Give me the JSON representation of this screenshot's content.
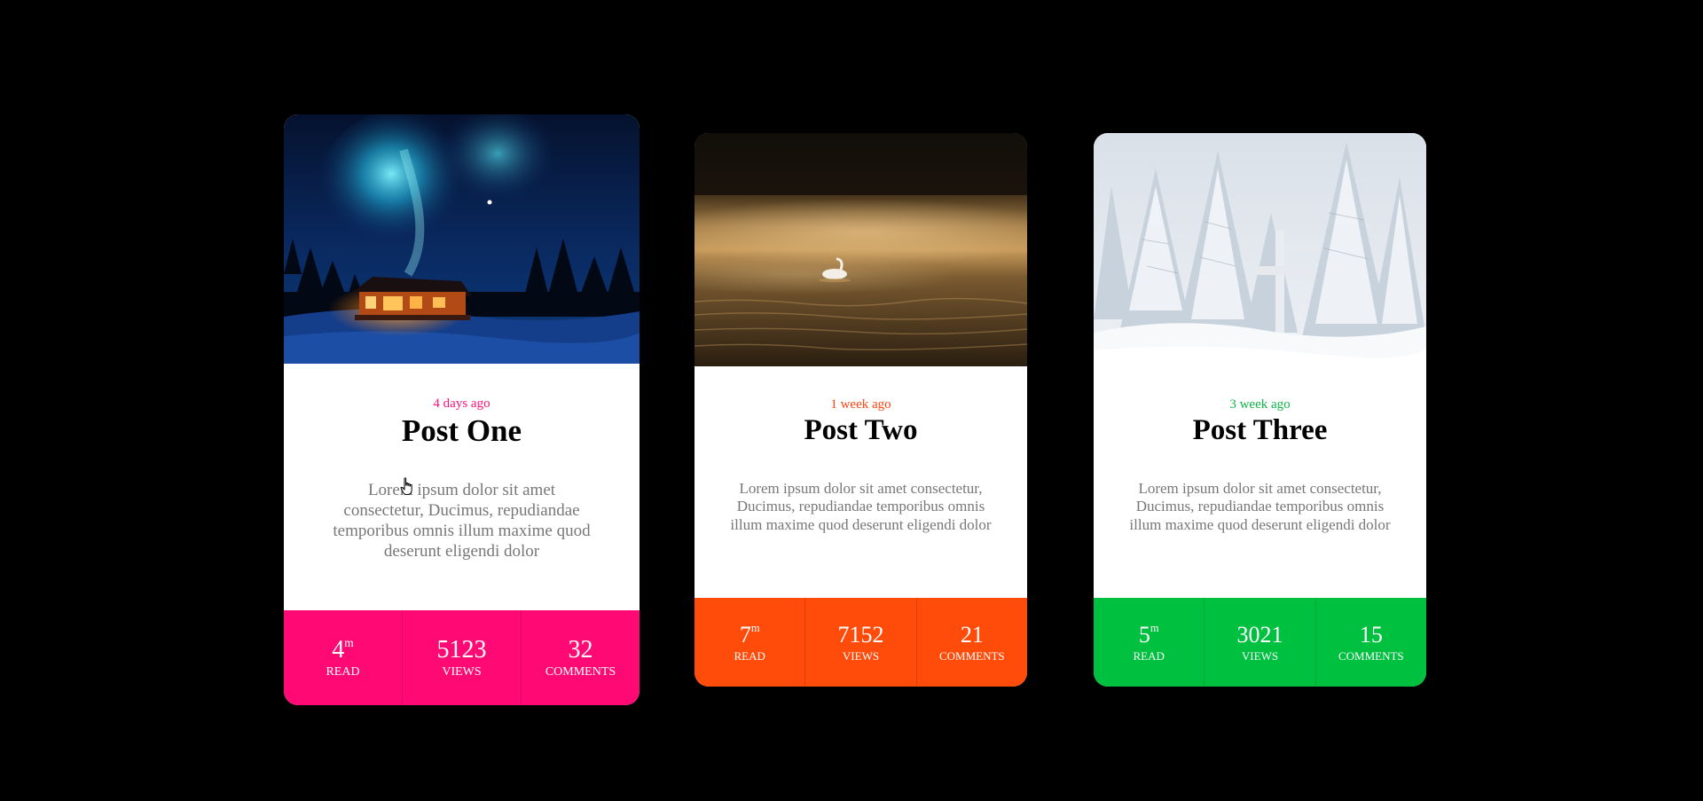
{
  "cards": [
    {
      "image": "northern-lights-cabin",
      "date": "4 days ago",
      "title": "Post One",
      "text": "Lorem ipsum dolor sit amet consectetur, Ducimus, repudiandae temporibus omnis illum maxime quod deserunt eligendi dolor",
      "accent": "#ff0a74",
      "stats": {
        "read": {
          "value": "4",
          "unit": "m",
          "label": "Read"
        },
        "views": {
          "value": "5123",
          "label": "Views"
        },
        "comments": {
          "value": "32",
          "label": "Comments"
        }
      }
    },
    {
      "image": "swan-on-lake",
      "date": "1 week ago",
      "title": "Post Two",
      "text": "Lorem ipsum dolor sit amet consectetur, Ducimus, repudiandae temporibus omnis illum maxime quod deserunt eligendi dolor",
      "accent": "#ff4c0b",
      "stats": {
        "read": {
          "value": "7",
          "unit": "m",
          "label": "Read"
        },
        "views": {
          "value": "7152",
          "label": "Views"
        },
        "comments": {
          "value": "21",
          "label": "Comments"
        }
      }
    },
    {
      "image": "snowy-forest",
      "date": "3 week ago",
      "title": "Post Three",
      "text": "Lorem ipsum dolor sit amet consectetur, Ducimus, repudiandae temporibus omnis illum maxime quod deserunt eligendi dolor",
      "accent": "#00c040",
      "stats": {
        "read": {
          "value": "5",
          "unit": "m",
          "label": "Read"
        },
        "views": {
          "value": "3021",
          "label": "Views"
        },
        "comments": {
          "value": "15",
          "label": "Comments"
        }
      }
    }
  ]
}
